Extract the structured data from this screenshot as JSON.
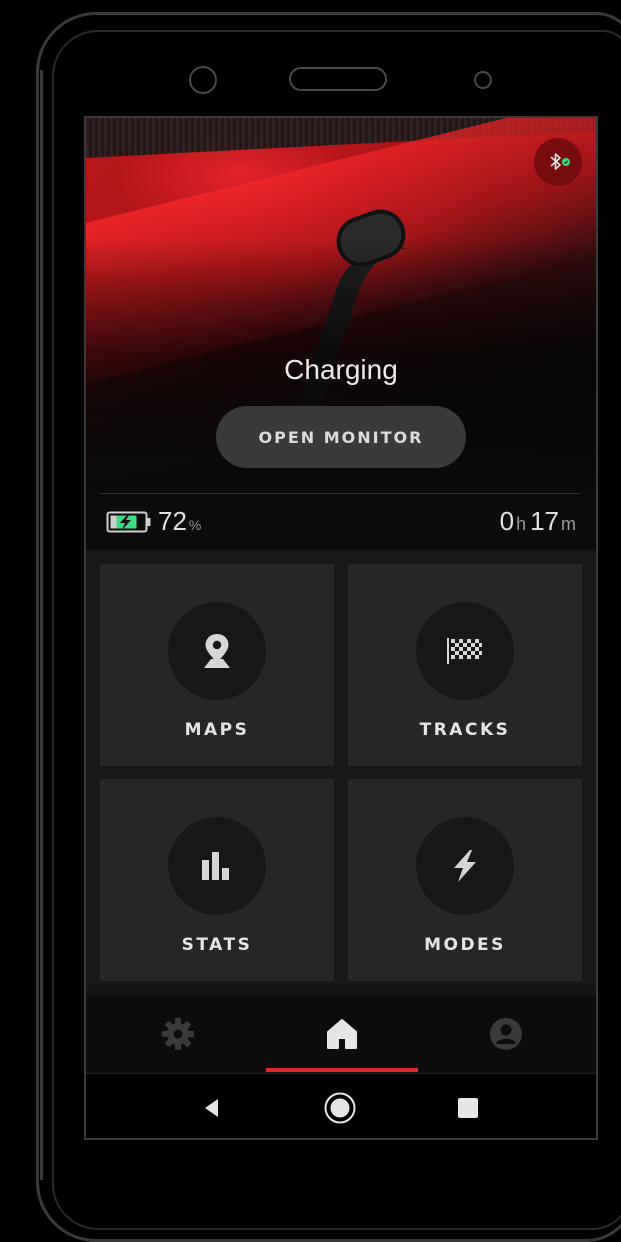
{
  "hero": {
    "status_title": "Charging",
    "monitor_button_label": "OPEN MONITOR",
    "bluetooth_badge": "bluetooth-connected-icon"
  },
  "status": {
    "battery_percent": "72",
    "battery_unit": "%",
    "battery_icon": "battery-charging-icon",
    "time_hours": "0",
    "time_hours_unit": "h",
    "time_minutes": "17",
    "time_minutes_unit": "m"
  },
  "tiles": [
    {
      "label": "MAPS",
      "icon": "map-pin-icon"
    },
    {
      "label": "TRACKS",
      "icon": "checkered-flag-icon"
    },
    {
      "label": "STATS",
      "icon": "bar-chart-icon"
    },
    {
      "label": "MODES",
      "icon": "lightning-icon"
    }
  ],
  "bottom_nav": {
    "items": [
      {
        "icon": "gear-icon"
      },
      {
        "icon": "home-icon",
        "active": true
      },
      {
        "icon": "profile-icon"
      }
    ]
  },
  "system_nav": {
    "items": [
      {
        "icon": "back-triangle-icon"
      },
      {
        "icon": "home-circle-icon"
      },
      {
        "icon": "recent-square-icon"
      }
    ]
  },
  "colors": {
    "accent": "#e12a2a",
    "bluetooth_ok": "#3ddc84",
    "tile_bg": "#262626",
    "screen_bg": "#141414"
  }
}
